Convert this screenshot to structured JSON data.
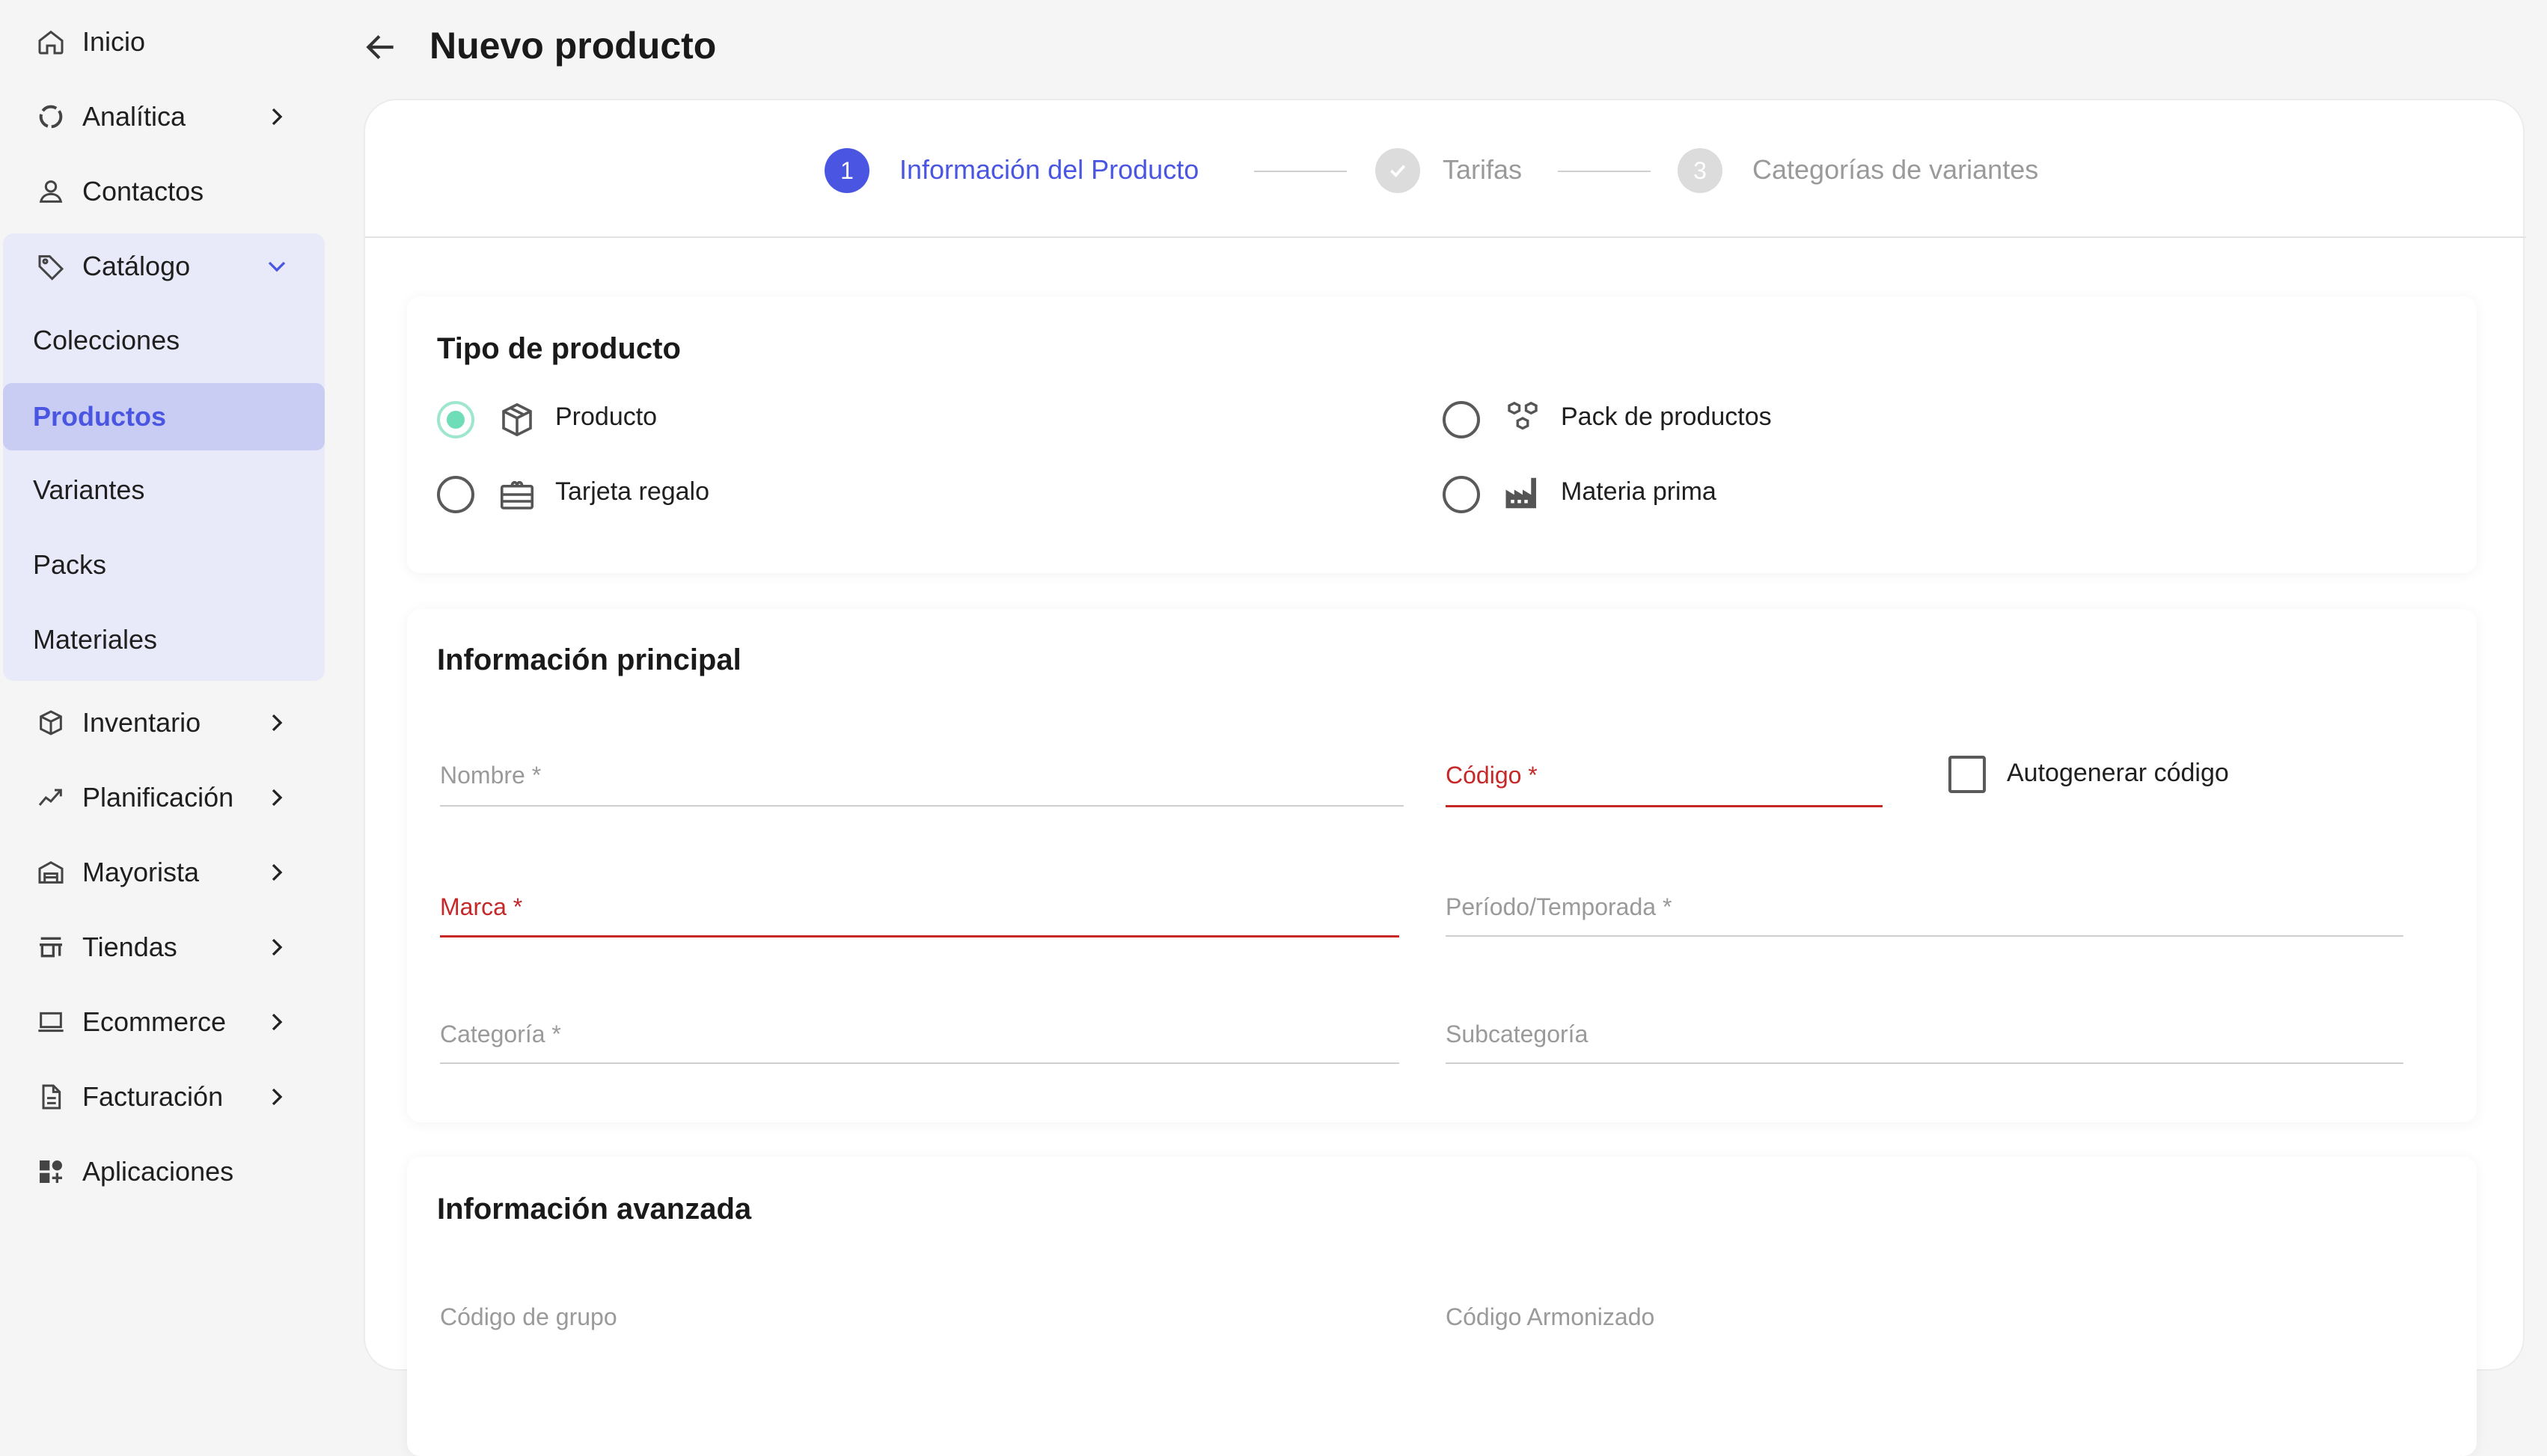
{
  "sidebar": {
    "items": [
      {
        "label": "Inicio",
        "icon": "home-icon"
      },
      {
        "label": "Analítica",
        "icon": "chart-icon"
      },
      {
        "label": "Contactos",
        "icon": "user-icon"
      },
      {
        "label": "Catálogo",
        "icon": "tag-icon"
      },
      {
        "label": "Inventario",
        "icon": "box-icon"
      },
      {
        "label": "Planificación",
        "icon": "trend-icon"
      },
      {
        "label": "Mayorista",
        "icon": "warehouse-icon"
      },
      {
        "label": "Tiendas",
        "icon": "store-icon"
      },
      {
        "label": "Ecommerce",
        "icon": "laptop-icon"
      },
      {
        "label": "Facturación",
        "icon": "document-icon"
      },
      {
        "label": "Aplicaciones",
        "icon": "apps-icon"
      }
    ],
    "catalog_sub": [
      "Colecciones",
      "Productos",
      "Variantes",
      "Packs",
      "Materiales"
    ],
    "active_sub": "Productos",
    "active_color": "#4a56e2"
  },
  "header": {
    "title": "Nuevo producto"
  },
  "stepper": {
    "steps": [
      {
        "number": "1",
        "label": "Información del Producto",
        "state": "active"
      },
      {
        "number": "",
        "label": "Tarifas",
        "state": "done"
      },
      {
        "number": "3",
        "label": "Categorías de variantes",
        "state": "pending"
      }
    ]
  },
  "product_type": {
    "title": "Tipo de producto",
    "options": [
      {
        "label": "Producto",
        "icon": "package-icon",
        "selected": true
      },
      {
        "label": "Pack de productos",
        "icon": "packs-icon",
        "selected": false
      },
      {
        "label": "Tarjeta regalo",
        "icon": "gift-card-icon",
        "selected": false
      },
      {
        "label": "Materia prima",
        "icon": "factory-icon",
        "selected": false
      }
    ]
  },
  "main_info": {
    "title": "Información principal",
    "fields": {
      "nombre": "Nombre *",
      "codigo": "Código *",
      "autogenerar": "Autogenerar código",
      "marca": "Marca *",
      "periodo": "Período/Temporada *",
      "categoria": "Categoría *",
      "subcategoria": "Subcategoría"
    }
  },
  "advanced_info": {
    "title": "Información avanzada",
    "fields": {
      "codigo_grupo": "Código de grupo",
      "codigo_armonizado": "Código Armonizado"
    }
  }
}
